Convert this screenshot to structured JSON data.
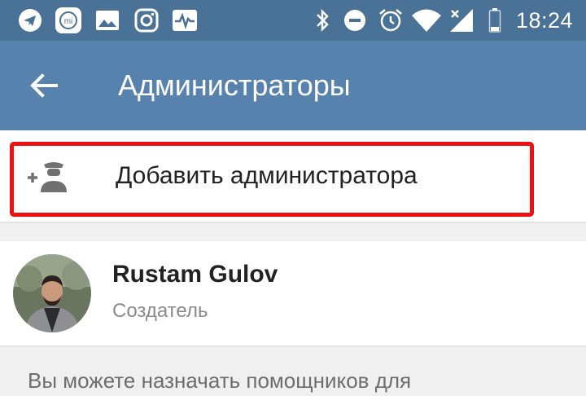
{
  "status_bar": {
    "time": "18:24",
    "icons": [
      "telegram-icon",
      "mi-icon",
      "image-icon",
      "instagram-icon",
      "activity-icon",
      "bluetooth-icon",
      "do-not-disturb-icon",
      "alarm-icon",
      "wifi-icon",
      "signal-icon",
      "battery-icon"
    ]
  },
  "toolbar": {
    "title": "Администраторы"
  },
  "add_admin": {
    "label": "Добавить администратора",
    "highlight_color": "#ee1111"
  },
  "members": [
    {
      "name": "Rustam Gulov",
      "role": "Создатель"
    }
  ],
  "info": {
    "text": "Вы можете назначать помощников для"
  },
  "colors": {
    "status_bar": "#4a7196",
    "toolbar": "#5682ad",
    "background": "#f0f0f0"
  }
}
